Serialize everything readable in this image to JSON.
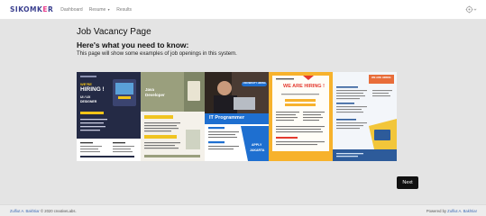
{
  "navbar": {
    "brand_main": "SIKOMK",
    "brand_accent": "E",
    "brand_end": "R",
    "links": [
      "Dashboard",
      "Resume",
      "Results"
    ]
  },
  "content": {
    "page_title": "Job Vacancy Page",
    "subtitle": "Here's what you need to know:",
    "description": "This page will show some examples of job openings in this system."
  },
  "posters": {
    "p1": {
      "line1": "WE'RE",
      "line2": "HIRING !",
      "line3": "UI / UX",
      "line4": "DESIGNER"
    },
    "p2": {
      "line1": "Java",
      "line2": "Developer"
    },
    "p3": {
      "badge": "UNIVERSITY HIRING",
      "title": "IT Programmer",
      "line1": "APPLY",
      "line2": "JAKARTA"
    },
    "p4": {
      "title": "WE ARE HIRING !"
    },
    "p5": {
      "title": "WE ARE HIRING"
    }
  },
  "actions": {
    "next_label": "Next"
  },
  "footer": {
    "author": "Zulfiut A. Bakhtiar",
    "copyright": " © 2020 creativeLabs.",
    "powered_label": "Powered by ",
    "powered_author": "Zulfiut A. Bakhtiar"
  },
  "colors": {
    "brand": "#3a3f8f",
    "accent": "#e83e8c",
    "background": "#e4e4e4",
    "button": "#111111",
    "link": "#3f6bb5"
  },
  "icons": {
    "user_menu": "user-gear-icon",
    "resume_dropdown": "caret-down-icon"
  }
}
